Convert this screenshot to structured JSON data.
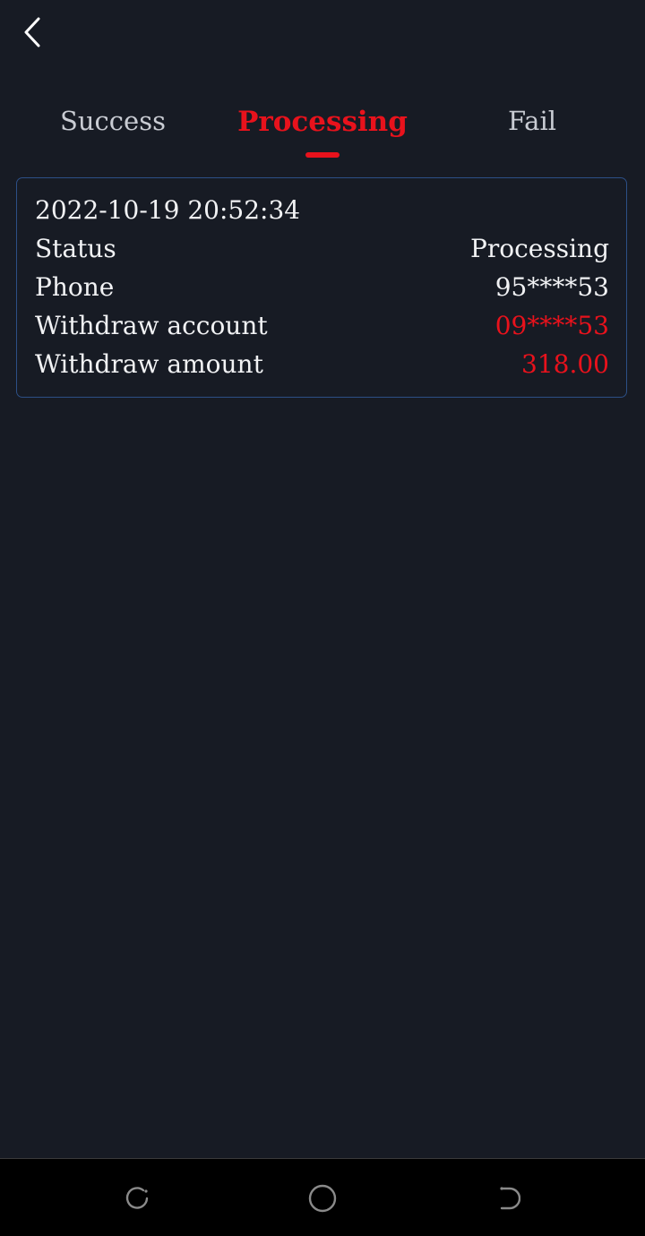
{
  "header": {
    "back_icon": "chevron-left-icon"
  },
  "tabs": [
    {
      "label": "Success",
      "active": false
    },
    {
      "label": "Processing",
      "active": true
    },
    {
      "label": "Fail",
      "active": false
    }
  ],
  "colors": {
    "background": "#171b24",
    "accent": "#e8121c",
    "card_border": "#2c4f86",
    "text": "#f1f2f4",
    "muted_text": "#c9ccd3"
  },
  "record": {
    "datetime": "2022-10-19 20:52:34",
    "rows": [
      {
        "label": "Status",
        "value": "Processing"
      },
      {
        "label": "Phone",
        "value": "95****53"
      },
      {
        "label": "Withdraw account",
        "value": "09****53"
      },
      {
        "label": "Withdraw amount",
        "value": "318.00"
      }
    ]
  },
  "navbar": {
    "recent_icon": "recent-apps-icon",
    "home_icon": "home-circle-icon",
    "back_icon": "system-back-icon"
  }
}
